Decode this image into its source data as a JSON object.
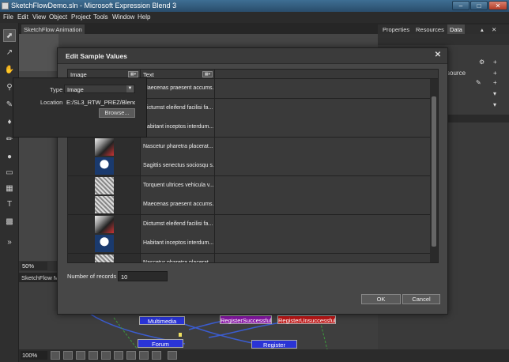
{
  "window": {
    "title": "SketchFlowDemo.sln - Microsoft Expression Blend 3",
    "min": "–",
    "max": "□",
    "close": "✕"
  },
  "menu": [
    "File",
    "Edit",
    "View",
    "Object",
    "Project",
    "Tools",
    "Window",
    "Help"
  ],
  "tabs": {
    "sketchflow": "SketchFlow Animation",
    "properties": "Properties",
    "resources": "Resources",
    "data": "Data"
  },
  "right_panel": {
    "source_fragment": "source"
  },
  "type_popup": {
    "type_label": "Type",
    "type_value": "Image",
    "location_label": "Location",
    "location_value": "E:/SL3_RTW_PREZ/Blend3_Sk",
    "browse_label": "Browse..."
  },
  "canvas": {
    "zoom": "50%",
    "map_tab": "SketchFlow M",
    "status_zoom": "100%"
  },
  "sketchflow_map": {
    "nodes": [
      "Multimedia",
      "RegisterSuccessful",
      "RegisterUnsuccessful",
      "Forum",
      "Register"
    ]
  },
  "dialog": {
    "title": "Edit Sample Values",
    "columns": [
      "Image",
      "Text"
    ],
    "rows": [
      {
        "text": "Maecenas praesent accums..."
      },
      {
        "text": "Dictumst eleifend facilisi fa..."
      },
      {
        "text": "Habitant inceptos interdum..."
      },
      {
        "text": "Nascetur pharetra placerat..."
      },
      {
        "text": "Sagittis senectus sociosqu s..."
      },
      {
        "text": "Torquent ultrices vehicula v..."
      },
      {
        "text": "Maecenas praesent accums..."
      },
      {
        "text": "Dictumst eleifend facilisi fa..."
      },
      {
        "text": "Habitant inceptos interdum..."
      },
      {
        "text": "Nascetur pharetra placerat..."
      }
    ],
    "records_label": "Number of records",
    "records_value": "10",
    "ok_label": "OK",
    "cancel_label": "Cancel",
    "close_glyph": "✕"
  }
}
